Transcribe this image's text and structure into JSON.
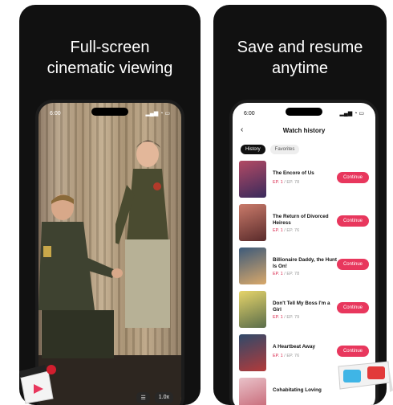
{
  "left_card": {
    "headline": "Full-screen\ncinematic viewing",
    "status_time": "6:00",
    "controls": {
      "episodes_icon": "list-icon",
      "speed": "1.0x"
    }
  },
  "right_card": {
    "headline": "Save and resume\nanytime",
    "status_time": "6:00",
    "nav_title": "Watch history",
    "tabs": [
      "History",
      "Favorites"
    ],
    "continue_label": "Continue",
    "items": [
      {
        "title": "The Encore of Us",
        "ep": "EP. 1",
        "total": "/ EP. 78",
        "poster": [
          "#b24a64",
          "#3a2a5c"
        ]
      },
      {
        "title": "The Return of Divorced Heiress",
        "ep": "EP. 1",
        "total": "/ EP. 76",
        "poster": [
          "#c97a6a",
          "#5a2b2b"
        ]
      },
      {
        "title": "Billionaire Daddy, the Hunt Is On!",
        "ep": "EP. 1",
        "total": "/ EP. 78",
        "poster": [
          "#3d5a7a",
          "#d9a86a"
        ]
      },
      {
        "title": "Don't Tell My Boss I'm a Girl",
        "ep": "EP. 1",
        "total": "/ EP. 79",
        "poster": [
          "#e6d46a",
          "#5a6d4a"
        ]
      },
      {
        "title": "A Heartbeat Away",
        "ep": "EP. 1",
        "total": "/ EP. 76",
        "poster": [
          "#2f4a6a",
          "#b33a3a"
        ]
      },
      {
        "title": "Cohabitating Loving",
        "ep": "",
        "total": "",
        "poster": [
          "#e9c2c9",
          "#c25a6a"
        ]
      }
    ]
  },
  "colors": {
    "accent": "#e8375d",
    "card_bg": "#111111"
  }
}
